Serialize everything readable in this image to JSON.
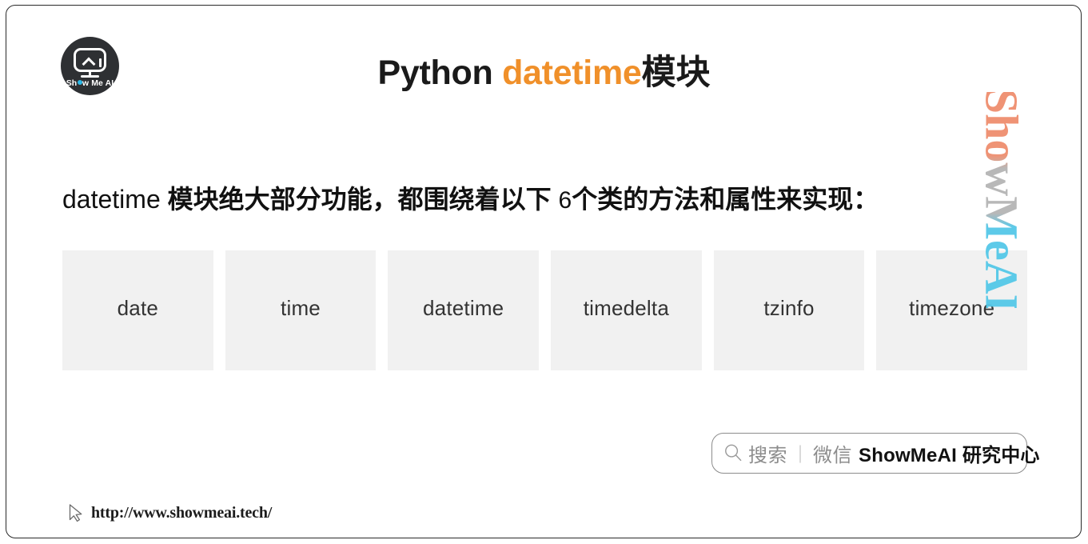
{
  "slide": {
    "background_color": "#ffffff",
    "border_color": "#2a2a2a",
    "accent_color": "#f0902a",
    "box_fill_color": "#f1f1f1"
  },
  "logo": {
    "brand_text_a": "Sh",
    "brand_text_b": "w Me AI",
    "dot_color": "#2bb8e8",
    "circle_color": "#2e3033"
  },
  "title": {
    "prefix": "Python ",
    "accent": "datetime",
    "suffix": "模块"
  },
  "lead": {
    "module_word": "datetime",
    "part1": " 模块绝大部分功能，都围绕着以下 ",
    "count": "6",
    "part2": "个类的方法和属性来实现："
  },
  "classes": {
    "items": [
      {
        "label": "date"
      },
      {
        "label": "time"
      },
      {
        "label": "datetime"
      },
      {
        "label": "timedelta"
      },
      {
        "label": "tzinfo"
      },
      {
        "label": "timezone"
      }
    ]
  },
  "watermark": {
    "text": "ShowMeAI"
  },
  "badge": {
    "search_label": "搜索",
    "separator": "｜",
    "channel_label": "微信",
    "account_label": "ShowMeAI 研究中心"
  },
  "footer": {
    "url": "http://www.showmeai.tech/"
  }
}
